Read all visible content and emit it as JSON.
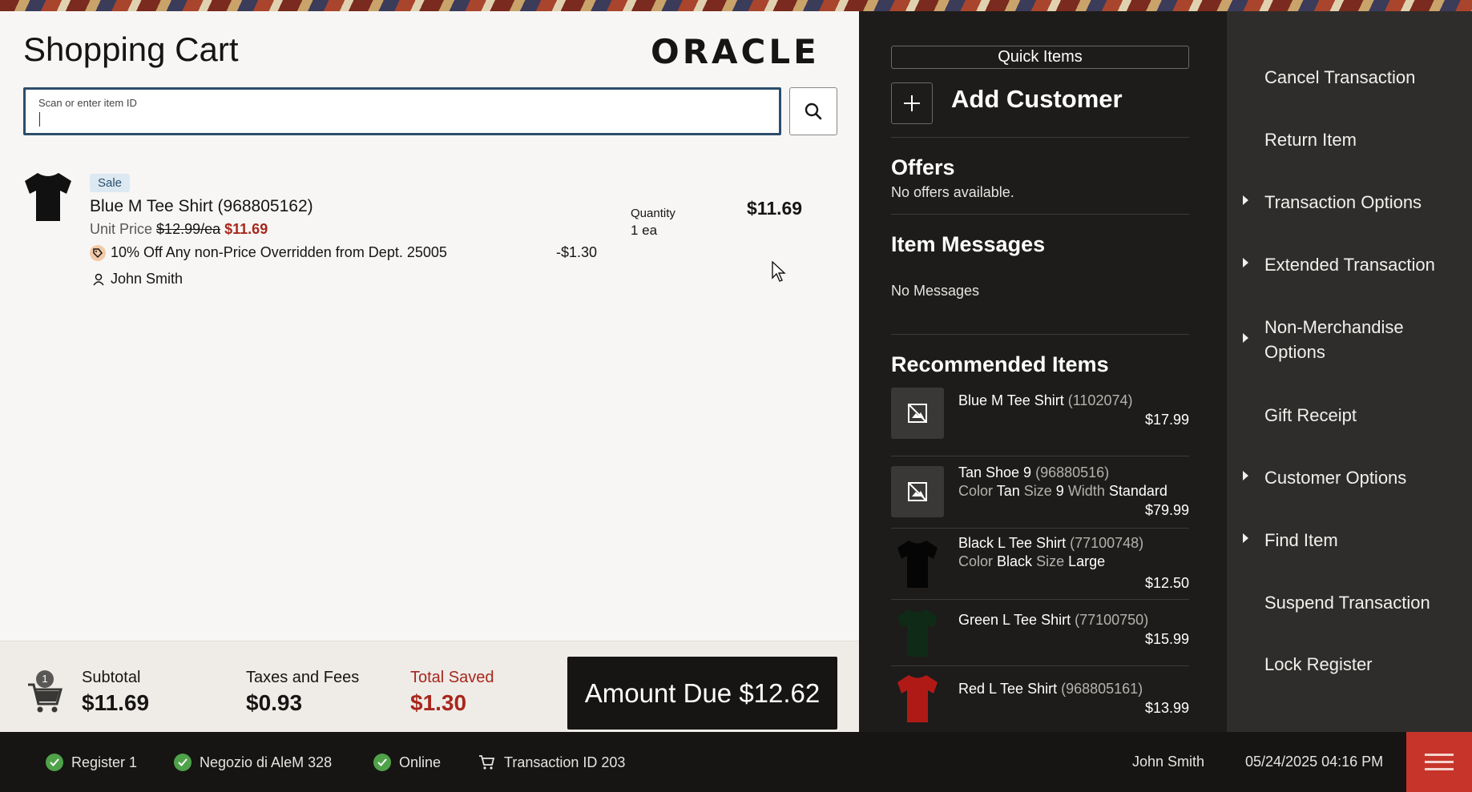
{
  "cart": {
    "title": "Shopping Cart",
    "logo": "ORACLE",
    "scan_placeholder": "Scan or enter item ID"
  },
  "line_item": {
    "badge": "Sale",
    "name": "Blue M Tee Shirt (968805162)",
    "unit_price_label": "Unit Price",
    "unit_price_original": "$12.99/ea",
    "unit_price_sale": "$11.69",
    "promo_text": "10% Off Any non-Price Overridden from Dept. 25005",
    "promo_amount": "-$1.30",
    "sales_person": "John Smith",
    "quantity_label": "Quantity",
    "quantity_value": "1 ea",
    "total": "$11.69"
  },
  "totals": {
    "cart_count": "1",
    "subtotal_label": "Subtotal",
    "subtotal_value": "$11.69",
    "taxes_label": "Taxes and Fees",
    "taxes_value": "$0.93",
    "saved_label": "Total Saved",
    "saved_value": "$1.30",
    "amount_due": "Amount Due $12.62"
  },
  "quick": {
    "quick_items": "Quick Items",
    "add_customer": "Add Customer",
    "offers_title": "Offers",
    "offers_text": "No offers available.",
    "messages_title": "Item Messages",
    "messages_text": "No Messages",
    "recommended_title": "Recommended Items",
    "recommended": [
      {
        "name": "Blue M Tee Shirt",
        "id": "(1102074)",
        "attrs": "",
        "price": "$17.99"
      },
      {
        "name": "Tan Shoe 9",
        "id": "(96880516)",
        "color_k": "Color",
        "color_v": "Tan",
        "size_k": "Size",
        "size_v": "9",
        "width_k": "Width",
        "width_v": "Standard",
        "price": "$79.99"
      },
      {
        "name": "Black L Tee Shirt",
        "id": "(77100748)",
        "color_k": "Color",
        "color_v": "Black",
        "size_k": "Size",
        "size_v": "Large",
        "price": "$12.50"
      },
      {
        "name": "Green L Tee Shirt",
        "id": "(77100750)",
        "price": "$15.99"
      },
      {
        "name": "Red L Tee Shirt",
        "id": "(968805161)",
        "price": "$13.99"
      }
    ]
  },
  "menu": {
    "items": [
      "Cancel Transaction",
      "Return Item",
      "Transaction Options",
      "Extended Transaction",
      "Non-Merchandise",
      "Options",
      "Gift Receipt",
      "Customer Options",
      "Find Item",
      "Suspend Transaction",
      "Lock Register"
    ]
  },
  "status": {
    "register": "Register 1",
    "store": "Negozio di AleM 328",
    "online": "Online",
    "transaction": "Transaction ID 203",
    "user": "John Smith",
    "datetime": "05/24/2025 04:16 PM"
  },
  "colors": {
    "accent_red": "#a8271c",
    "dark_panel": "#1d1c1a",
    "menu_panel": "#2e2d2b",
    "status_green": "#4fa24a",
    "hamburger_red": "#c7352a"
  }
}
